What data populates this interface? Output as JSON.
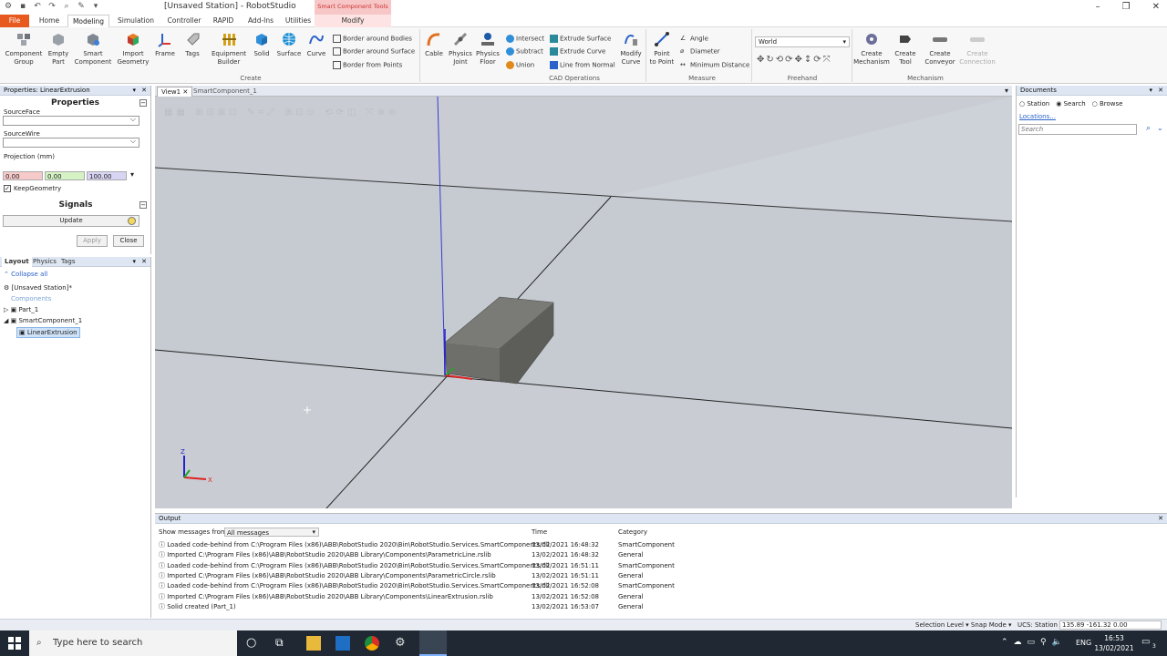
{
  "window": {
    "title": "[Unsaved Station] - RobotStudio",
    "contextual_tab": "Smart Component Tools"
  },
  "tabs": [
    "File",
    "Home",
    "Modeling",
    "Simulation",
    "Controller",
    "RAPID",
    "Add-Ins",
    "Utilities",
    "Modify"
  ],
  "ribbon": {
    "create": {
      "component_group": "Component\nGroup",
      "empty_part": "Empty\nPart",
      "smart_component": "Smart\nComponent",
      "import_geometry": "Import\nGeometry",
      "frame": "Frame",
      "tags": "Tags",
      "equipment_builder": "Equipment\nBuilder",
      "solid": "Solid",
      "surface": "Surface",
      "curve": "Curve",
      "border_bodies": "Border around Bodies",
      "border_surface": "Border around Surface",
      "border_points": "Border from Points",
      "label": "Create"
    },
    "cad": {
      "cable": "Cable",
      "physics_joint": "Physics\nJoint",
      "physics_floor": "Physics\nFloor",
      "intersect": "Intersect",
      "subtract": "Subtract",
      "union": "Union",
      "extrude_surface": "Extrude Surface",
      "extrude_curve": "Extrude Curve",
      "line_normal": "Line from Normal",
      "modify_curve": "Modify\nCurve",
      "label": "CAD Operations"
    },
    "measure": {
      "point_to_point": "Point\nto Point",
      "angle": "Angle",
      "diameter": "Diameter",
      "min_distance": "Minimum Distance",
      "label": "Measure"
    },
    "freehand": {
      "reference": "World",
      "label": "Freehand"
    },
    "mechanism": {
      "create_mechanism": "Create\nMechanism",
      "create_tool": "Create\nTool",
      "create_conveyor": "Create\nConveyor",
      "create_connection": "Create\nConnection",
      "label": "Mechanism"
    }
  },
  "properties": {
    "header": "Properties: LinearExtrusion",
    "section_props": "Properties",
    "source_face": "SourceFace",
    "source_wire": "SourceWire",
    "projection_label": "Projection (mm)",
    "projection": [
      "0.00",
      "0.00",
      "100.00"
    ],
    "keep_geometry": "KeepGeometry",
    "section_signals": "Signals",
    "update": "Update",
    "apply": "Apply",
    "close": "Close"
  },
  "layout": {
    "tabs": [
      "Layout",
      "Physics",
      "Tags"
    ],
    "collapse_all": "Collapse all",
    "tree": {
      "station": "[Unsaved Station]*",
      "components": "Components",
      "part1": "Part_1",
      "smart1": "SmartComponent_1",
      "linear": "LinearExtrusion"
    }
  },
  "viewport": {
    "tabs": [
      "View1",
      "SmartComponent_1"
    ],
    "axis_z": "Z",
    "axis_x": "X"
  },
  "documents": {
    "title": "Documents",
    "options": [
      "Station",
      "Search",
      "Browse"
    ],
    "locations": "Locations...",
    "search_placeholder": "Search"
  },
  "output": {
    "title": "Output",
    "show_label": "Show messages from:",
    "filter": "All messages",
    "col_time": "Time",
    "col_category": "Category",
    "rows": [
      {
        "msg": "Loaded code-behind from C:\\Program Files (x86)\\ABB\\RobotStudio 2020\\Bin\\RobotStudio.Services.SmartComponents.dll",
        "time": "13/02/2021 16:48:32",
        "cat": "SmartComponent"
      },
      {
        "msg": "Imported C:\\Program Files (x86)\\ABB\\RobotStudio 2020\\ABB Library\\Components\\ParametricLine.rslib",
        "time": "13/02/2021 16:48:32",
        "cat": "General"
      },
      {
        "msg": "Loaded code-behind from C:\\Program Files (x86)\\ABB\\RobotStudio 2020\\Bin\\RobotStudio.Services.SmartComponents.dll",
        "time": "13/02/2021 16:51:11",
        "cat": "SmartComponent"
      },
      {
        "msg": "Imported C:\\Program Files (x86)\\ABB\\RobotStudio 2020\\ABB Library\\Components\\ParametricCircle.rslib",
        "time": "13/02/2021 16:51:11",
        "cat": "General"
      },
      {
        "msg": "Loaded code-behind from C:\\Program Files (x86)\\ABB\\RobotStudio 2020\\Bin\\RobotStudio.Services.SmartComponents.dll",
        "time": "13/02/2021 16:52:08",
        "cat": "SmartComponent"
      },
      {
        "msg": "Imported C:\\Program Files (x86)\\ABB\\RobotStudio 2020\\ABB Library\\Components\\LinearExtrusion.rslib",
        "time": "13/02/2021 16:52:08",
        "cat": "General"
      },
      {
        "msg": "Solid created (Part_1)",
        "time": "13/02/2021 16:53:07",
        "cat": "General"
      }
    ]
  },
  "statusbar": {
    "selection": "Selection Level ▾  Snap Mode ▾",
    "ucs": "UCS: Station",
    "coords": "135.89  -161.32  0.00"
  },
  "taskbar": {
    "search": "Type here to search",
    "lang": "ENG",
    "time": "16:53",
    "date": "13/02/2021",
    "notif": "3"
  }
}
